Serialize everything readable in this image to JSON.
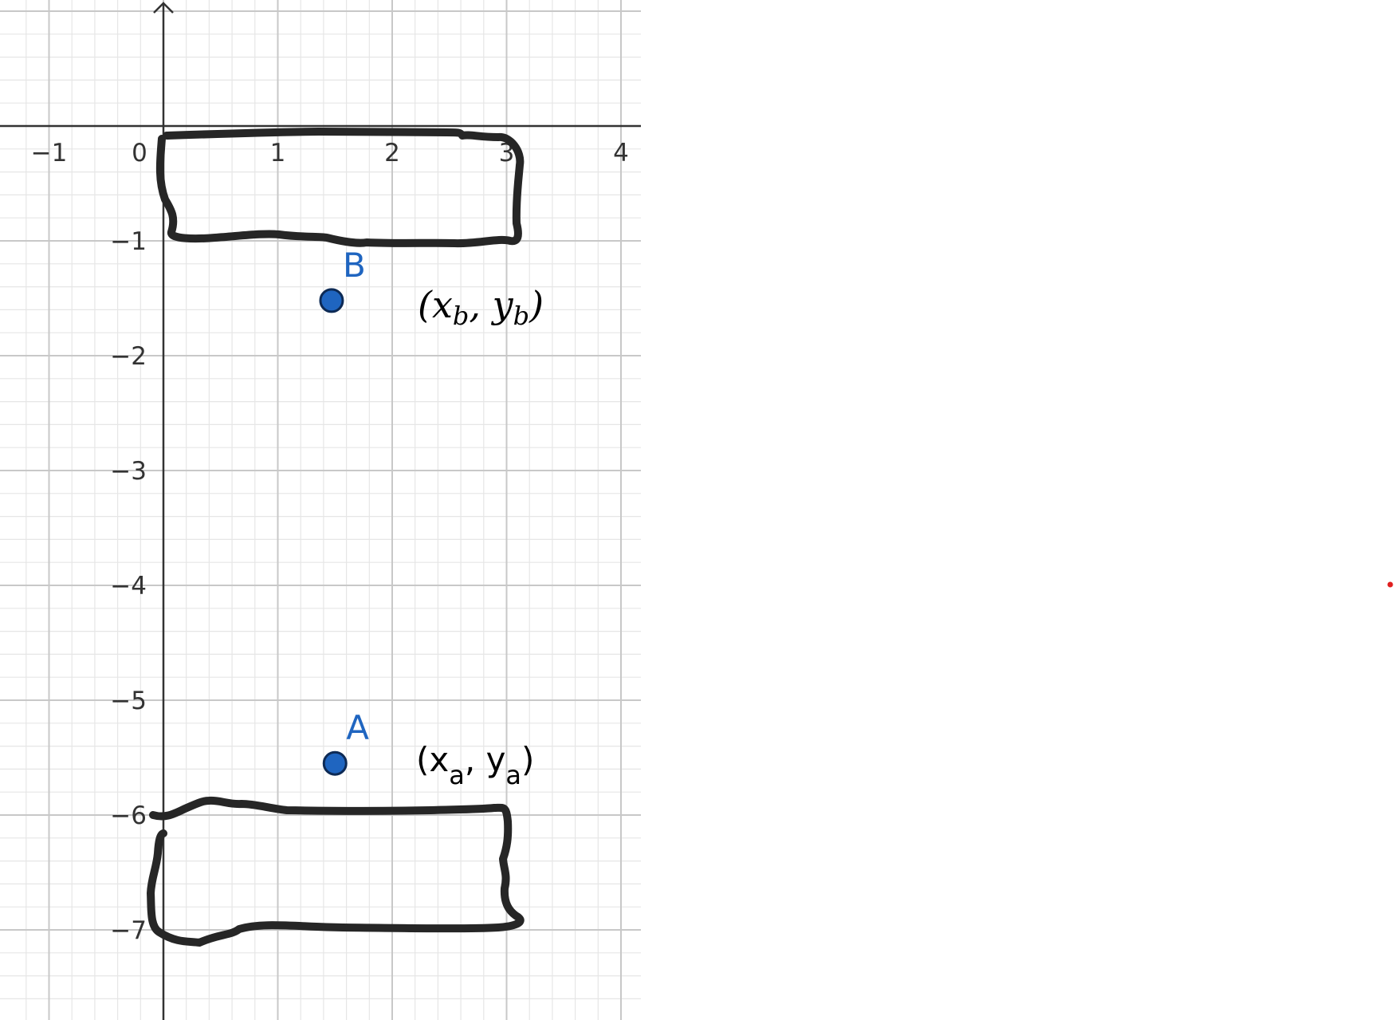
{
  "axes": {
    "x_ticks": [
      "−1",
      "0",
      "1",
      "2",
      "3",
      "4"
    ],
    "y_ticks": [
      "−1",
      "−2",
      "−3",
      "−4",
      "−5",
      "−6",
      "−7"
    ],
    "x_range": [
      -1.4,
      4.2
    ],
    "y_range": [
      -7.8,
      1.1
    ],
    "grid": true,
    "minor_grid_step": 0.2
  },
  "points": [
    {
      "id": "A",
      "label": "A",
      "x": 1.5,
      "y": -5.55,
      "color": "#1f65c0"
    },
    {
      "id": "B",
      "label": "B",
      "x": 1.47,
      "y": -1.52,
      "color": "#1f65c0"
    }
  ],
  "coordinate_labels": {
    "b": {
      "open": "(",
      "x": "x",
      "x_sub": "b",
      "sep": ", ",
      "y": "y",
      "y_sub": "b",
      "close": ")"
    },
    "a": {
      "open": "(",
      "x": "x",
      "x_sub": "a",
      "sep": ", ",
      "y": "y",
      "y_sub": "a",
      "close": ")"
    }
  },
  "colors": {
    "axis": "#333333",
    "major_grid": "#c8c8c8",
    "minor_grid": "#e6e6e6",
    "freehand_stroke": "#262626",
    "point_fill": "#1f65c0",
    "marker_dot": "#e02020"
  }
}
